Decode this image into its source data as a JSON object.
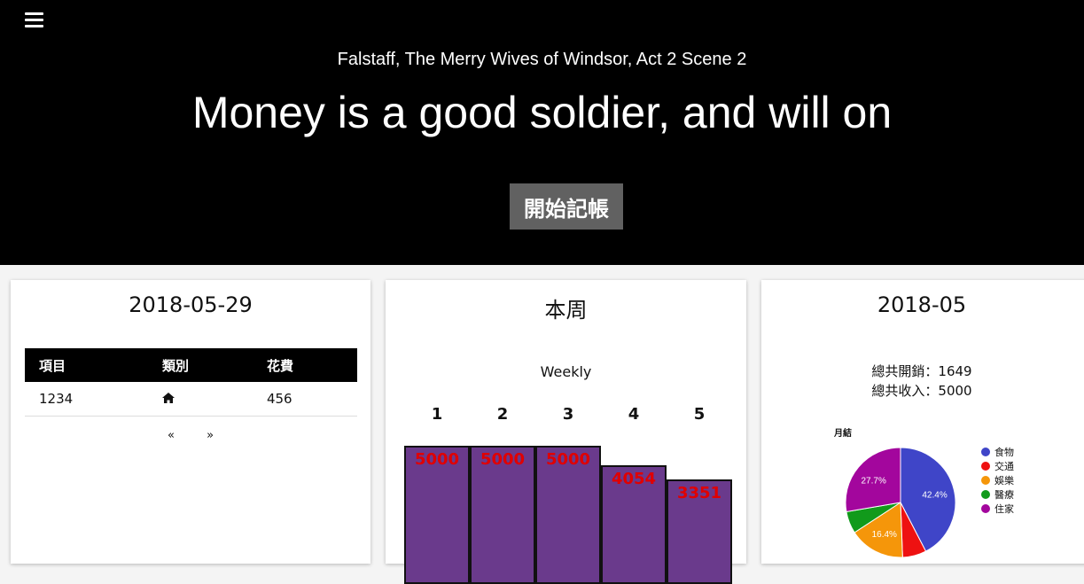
{
  "hero": {
    "subtitle": "Falstaff, The Merry Wives of Windsor, Act 2 Scene 2",
    "title": "Money is a good soldier, and will on",
    "button": "開始記帳"
  },
  "daily": {
    "date": "2018-05-29",
    "columns": [
      "項目",
      "類別",
      "花費"
    ],
    "rows": [
      {
        "item": "1234",
        "category_icon": "home-icon",
        "cost": "456"
      }
    ],
    "pager": {
      "prev": "«",
      "next": "»"
    }
  },
  "weekly": {
    "title": "本周",
    "label": "Weekly",
    "bar_color": "#6a3a8c",
    "label_color": "#e00000",
    "chart_data": {
      "type": "bar",
      "title": "Weekly",
      "categories": [
        "1",
        "2",
        "3",
        "4",
        "5"
      ],
      "values": [
        5000,
        5000,
        5000,
        4054,
        3351
      ]
    }
  },
  "monthly": {
    "month": "2018-05",
    "total_expense": "總共開銷：1649",
    "total_income": "總共收入：5000",
    "chart_data": {
      "type": "pie",
      "title": "月結",
      "categories": [
        "食物",
        "交通",
        "娛樂",
        "醫療",
        "住家"
      ],
      "values": [
        42.4,
        7.0,
        16.4,
        6.5,
        27.7
      ],
      "colors": [
        "#3f45c8",
        "#ee1111",
        "#f5960a",
        "#119a1b",
        "#a3069d"
      ],
      "labels": [
        "42.4%",
        "",
        "16.4%",
        "",
        "27.7%"
      ]
    }
  }
}
